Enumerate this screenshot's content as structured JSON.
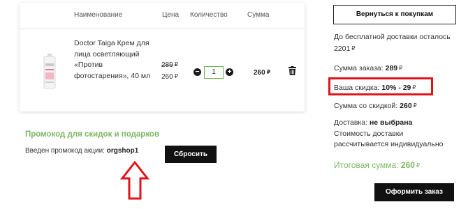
{
  "cart": {
    "headers": {
      "name": "Наименование",
      "price": "Цена",
      "qty": "Количество",
      "sum": "Сумма"
    },
    "item": {
      "name": "Doctor Taiga Крем для лица осветляющий «Против фотостарения», 40 мл",
      "price_old": "289",
      "price_new": "260",
      "quantity": "1",
      "sum": "260"
    },
    "currency_glyph": "₽"
  },
  "promo": {
    "title": "Промокод для скидок и подарков",
    "applied_label": "Введен промокод акции:",
    "code": "orgshop1",
    "reset_label": "Сбросить"
  },
  "summary": {
    "back_label": "Вернуться к покупкам",
    "free_ship": "До бесплатной доставки осталось 2201",
    "order_sum_label": "Сумма заказа:",
    "order_sum_value": "289",
    "discount_label": "Ваша скидка:",
    "discount_value": "10% - 29",
    "sum_discount_label": "Сумма со скидкой:",
    "sum_discount_value": "260",
    "delivery_label": "Доставка:",
    "delivery_value": "не выбрана",
    "delivery_note": "Стоимость доставки рассчитывается индивидуально",
    "total_label": "Итоговая сумма:",
    "total_value": "260",
    "checkout_label": "Оформить заказ"
  },
  "colors": {
    "accent_green": "#7bb862",
    "highlight_red": "#e0141b",
    "button_black": "#111111"
  },
  "icons": [
    "product-image",
    "minus-icon",
    "plus-icon",
    "trash-icon",
    "arrow-up-icon"
  ]
}
